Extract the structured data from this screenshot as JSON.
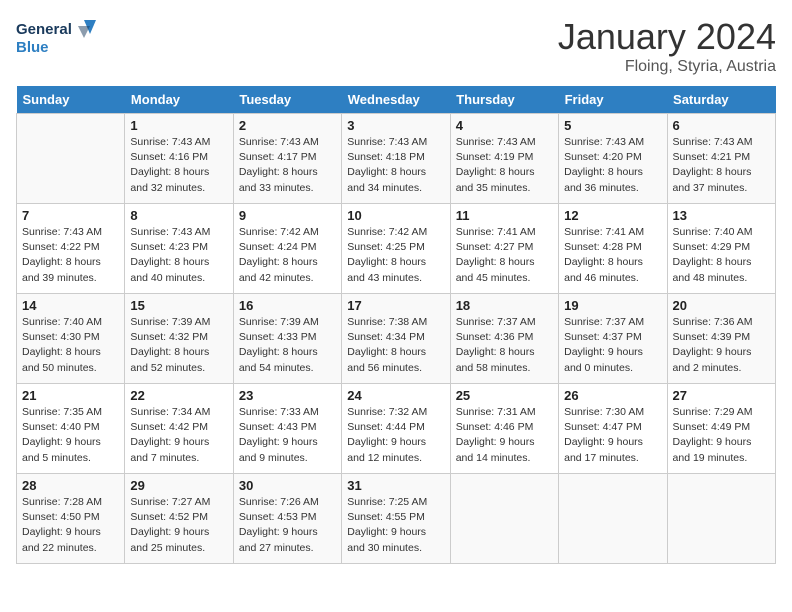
{
  "header": {
    "logo_line1": "General",
    "logo_line2": "Blue",
    "month_title": "January 2024",
    "location": "Floing, Styria, Austria"
  },
  "days_of_week": [
    "Sunday",
    "Monday",
    "Tuesday",
    "Wednesday",
    "Thursday",
    "Friday",
    "Saturday"
  ],
  "weeks": [
    [
      {
        "num": "",
        "sunrise": "",
        "sunset": "",
        "daylight": ""
      },
      {
        "num": "1",
        "sunrise": "Sunrise: 7:43 AM",
        "sunset": "Sunset: 4:16 PM",
        "daylight": "Daylight: 8 hours and 32 minutes."
      },
      {
        "num": "2",
        "sunrise": "Sunrise: 7:43 AM",
        "sunset": "Sunset: 4:17 PM",
        "daylight": "Daylight: 8 hours and 33 minutes."
      },
      {
        "num": "3",
        "sunrise": "Sunrise: 7:43 AM",
        "sunset": "Sunset: 4:18 PM",
        "daylight": "Daylight: 8 hours and 34 minutes."
      },
      {
        "num": "4",
        "sunrise": "Sunrise: 7:43 AM",
        "sunset": "Sunset: 4:19 PM",
        "daylight": "Daylight: 8 hours and 35 minutes."
      },
      {
        "num": "5",
        "sunrise": "Sunrise: 7:43 AM",
        "sunset": "Sunset: 4:20 PM",
        "daylight": "Daylight: 8 hours and 36 minutes."
      },
      {
        "num": "6",
        "sunrise": "Sunrise: 7:43 AM",
        "sunset": "Sunset: 4:21 PM",
        "daylight": "Daylight: 8 hours and 37 minutes."
      }
    ],
    [
      {
        "num": "7",
        "sunrise": "Sunrise: 7:43 AM",
        "sunset": "Sunset: 4:22 PM",
        "daylight": "Daylight: 8 hours and 39 minutes."
      },
      {
        "num": "8",
        "sunrise": "Sunrise: 7:43 AM",
        "sunset": "Sunset: 4:23 PM",
        "daylight": "Daylight: 8 hours and 40 minutes."
      },
      {
        "num": "9",
        "sunrise": "Sunrise: 7:42 AM",
        "sunset": "Sunset: 4:24 PM",
        "daylight": "Daylight: 8 hours and 42 minutes."
      },
      {
        "num": "10",
        "sunrise": "Sunrise: 7:42 AM",
        "sunset": "Sunset: 4:25 PM",
        "daylight": "Daylight: 8 hours and 43 minutes."
      },
      {
        "num": "11",
        "sunrise": "Sunrise: 7:41 AM",
        "sunset": "Sunset: 4:27 PM",
        "daylight": "Daylight: 8 hours and 45 minutes."
      },
      {
        "num": "12",
        "sunrise": "Sunrise: 7:41 AM",
        "sunset": "Sunset: 4:28 PM",
        "daylight": "Daylight: 8 hours and 46 minutes."
      },
      {
        "num": "13",
        "sunrise": "Sunrise: 7:40 AM",
        "sunset": "Sunset: 4:29 PM",
        "daylight": "Daylight: 8 hours and 48 minutes."
      }
    ],
    [
      {
        "num": "14",
        "sunrise": "Sunrise: 7:40 AM",
        "sunset": "Sunset: 4:30 PM",
        "daylight": "Daylight: 8 hours and 50 minutes."
      },
      {
        "num": "15",
        "sunrise": "Sunrise: 7:39 AM",
        "sunset": "Sunset: 4:32 PM",
        "daylight": "Daylight: 8 hours and 52 minutes."
      },
      {
        "num": "16",
        "sunrise": "Sunrise: 7:39 AM",
        "sunset": "Sunset: 4:33 PM",
        "daylight": "Daylight: 8 hours and 54 minutes."
      },
      {
        "num": "17",
        "sunrise": "Sunrise: 7:38 AM",
        "sunset": "Sunset: 4:34 PM",
        "daylight": "Daylight: 8 hours and 56 minutes."
      },
      {
        "num": "18",
        "sunrise": "Sunrise: 7:37 AM",
        "sunset": "Sunset: 4:36 PM",
        "daylight": "Daylight: 8 hours and 58 minutes."
      },
      {
        "num": "19",
        "sunrise": "Sunrise: 7:37 AM",
        "sunset": "Sunset: 4:37 PM",
        "daylight": "Daylight: 9 hours and 0 minutes."
      },
      {
        "num": "20",
        "sunrise": "Sunrise: 7:36 AM",
        "sunset": "Sunset: 4:39 PM",
        "daylight": "Daylight: 9 hours and 2 minutes."
      }
    ],
    [
      {
        "num": "21",
        "sunrise": "Sunrise: 7:35 AM",
        "sunset": "Sunset: 4:40 PM",
        "daylight": "Daylight: 9 hours and 5 minutes."
      },
      {
        "num": "22",
        "sunrise": "Sunrise: 7:34 AM",
        "sunset": "Sunset: 4:42 PM",
        "daylight": "Daylight: 9 hours and 7 minutes."
      },
      {
        "num": "23",
        "sunrise": "Sunrise: 7:33 AM",
        "sunset": "Sunset: 4:43 PM",
        "daylight": "Daylight: 9 hours and 9 minutes."
      },
      {
        "num": "24",
        "sunrise": "Sunrise: 7:32 AM",
        "sunset": "Sunset: 4:44 PM",
        "daylight": "Daylight: 9 hours and 12 minutes."
      },
      {
        "num": "25",
        "sunrise": "Sunrise: 7:31 AM",
        "sunset": "Sunset: 4:46 PM",
        "daylight": "Daylight: 9 hours and 14 minutes."
      },
      {
        "num": "26",
        "sunrise": "Sunrise: 7:30 AM",
        "sunset": "Sunset: 4:47 PM",
        "daylight": "Daylight: 9 hours and 17 minutes."
      },
      {
        "num": "27",
        "sunrise": "Sunrise: 7:29 AM",
        "sunset": "Sunset: 4:49 PM",
        "daylight": "Daylight: 9 hours and 19 minutes."
      }
    ],
    [
      {
        "num": "28",
        "sunrise": "Sunrise: 7:28 AM",
        "sunset": "Sunset: 4:50 PM",
        "daylight": "Daylight: 9 hours and 22 minutes."
      },
      {
        "num": "29",
        "sunrise": "Sunrise: 7:27 AM",
        "sunset": "Sunset: 4:52 PM",
        "daylight": "Daylight: 9 hours and 25 minutes."
      },
      {
        "num": "30",
        "sunrise": "Sunrise: 7:26 AM",
        "sunset": "Sunset: 4:53 PM",
        "daylight": "Daylight: 9 hours and 27 minutes."
      },
      {
        "num": "31",
        "sunrise": "Sunrise: 7:25 AM",
        "sunset": "Sunset: 4:55 PM",
        "daylight": "Daylight: 9 hours and 30 minutes."
      },
      {
        "num": "",
        "sunrise": "",
        "sunset": "",
        "daylight": ""
      },
      {
        "num": "",
        "sunrise": "",
        "sunset": "",
        "daylight": ""
      },
      {
        "num": "",
        "sunrise": "",
        "sunset": "",
        "daylight": ""
      }
    ]
  ]
}
